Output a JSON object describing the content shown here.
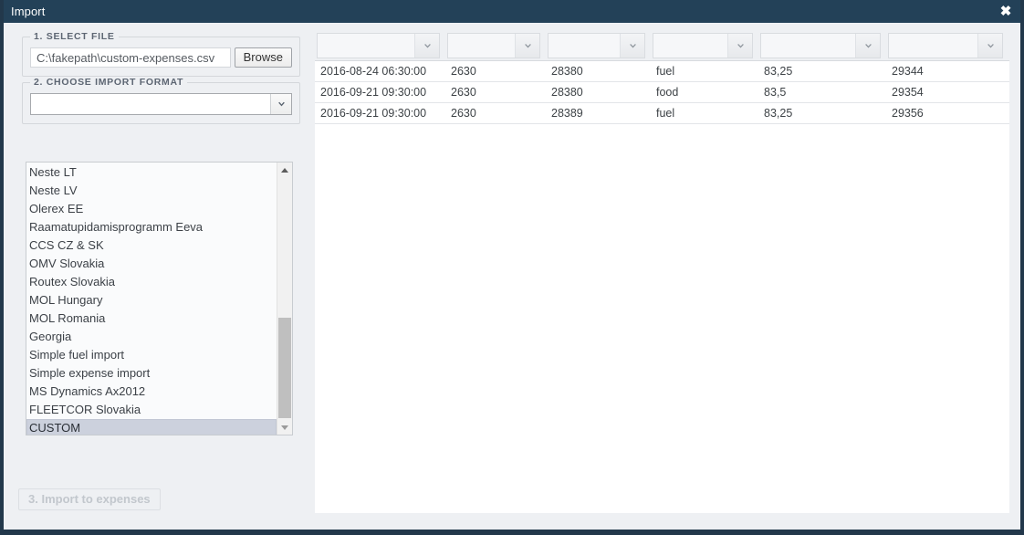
{
  "window": {
    "title": "Import",
    "close_label": "✖"
  },
  "left": {
    "select_file": {
      "legend": "1. SELECT FILE",
      "path_value": "C:\\fakepath\\custom-expenses.csv",
      "browse_label": "Browse"
    },
    "choose_format": {
      "legend": "2. CHOOSE IMPORT FORMAT",
      "input_value": "",
      "input_placeholder": "",
      "options": [
        "Neste LT",
        "Neste LV",
        "Olerex EE",
        "Raamatupidamisprogramm Eeva",
        "CCS CZ & SK",
        "OMV Slovakia",
        "Routex Slovakia",
        "MOL Hungary",
        "MOL Romania",
        "Georgia",
        "Simple fuel import",
        "Simple expense import",
        "MS Dynamics Ax2012",
        "FLEETCOR Slovakia",
        "CUSTOM"
      ],
      "selected": "CUSTOM"
    },
    "import_button": {
      "label": "3. Import to expenses",
      "disabled": true
    }
  },
  "table": {
    "header_selects": [
      {
        "value": ""
      },
      {
        "value": ""
      },
      {
        "value": ""
      },
      {
        "value": ""
      },
      {
        "value": ""
      },
      {
        "value": ""
      }
    ],
    "rows": [
      [
        "2016-08-24 06:30:00",
        "2630",
        "28380",
        "fuel",
        "83,25",
        "29344"
      ],
      [
        "2016-09-21 09:30:00",
        "2630",
        "28380",
        "food",
        "83,5",
        "29354"
      ],
      [
        "2016-09-21 09:30:00",
        "2630",
        "28389",
        "fuel",
        "83,25",
        "29356"
      ]
    ]
  },
  "colors": {
    "titlebar": "#234158",
    "panel": "#eef0f3",
    "selection": "#ccd1dd",
    "text": "#3d4246"
  }
}
